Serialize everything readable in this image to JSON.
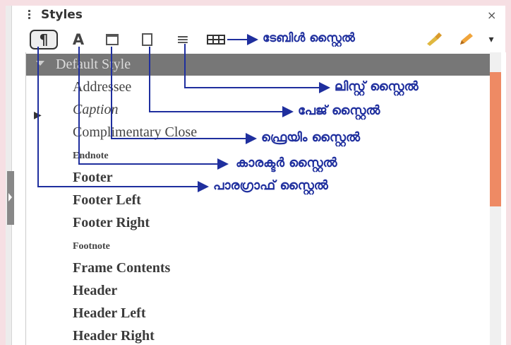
{
  "panel": {
    "title": "Styles",
    "close_symbol": "×"
  },
  "toolbar": {
    "buttons": [
      {
        "name": "paragraph-styles",
        "glyph": "¶"
      },
      {
        "name": "character-styles",
        "glyph": "A"
      },
      {
        "name": "frame-styles",
        "glyph": ""
      },
      {
        "name": "page-styles",
        "glyph": ""
      },
      {
        "name": "list-styles",
        "glyph": "≡"
      },
      {
        "name": "table-styles",
        "glyph": ""
      }
    ],
    "fill_format_glyph": "✎",
    "new_style_glyph": "✏",
    "dropdown_glyph": "▾"
  },
  "styles": {
    "default": "Default Style",
    "items": [
      "Addressee",
      "Caption",
      "Complimentary Close",
      "Endnote",
      "Footer",
      "Footer Left",
      "Footer Right",
      "Footnote",
      "Frame Contents",
      "Header",
      "Header Left",
      "Header Right"
    ]
  },
  "annotations": {
    "table": "ടേബിൾ സ്റ്റൈൽ",
    "list": "ലിസ്റ്റ് സ്റ്റൈൽ",
    "page": "പേജ് സ്റ്റൈൽ",
    "frame": "ഫ്രെയിം സ്റ്റൈൽ",
    "character": "കാരക്ടർ സ്റ്റൈൽ",
    "paragraph": "പാരഗ്രാഫ് സ്റ്റൈൽ"
  },
  "colors": {
    "annotation": "#1f2f9e",
    "selected_row": "#777777",
    "scroll_thumb": "#ee8a64"
  }
}
